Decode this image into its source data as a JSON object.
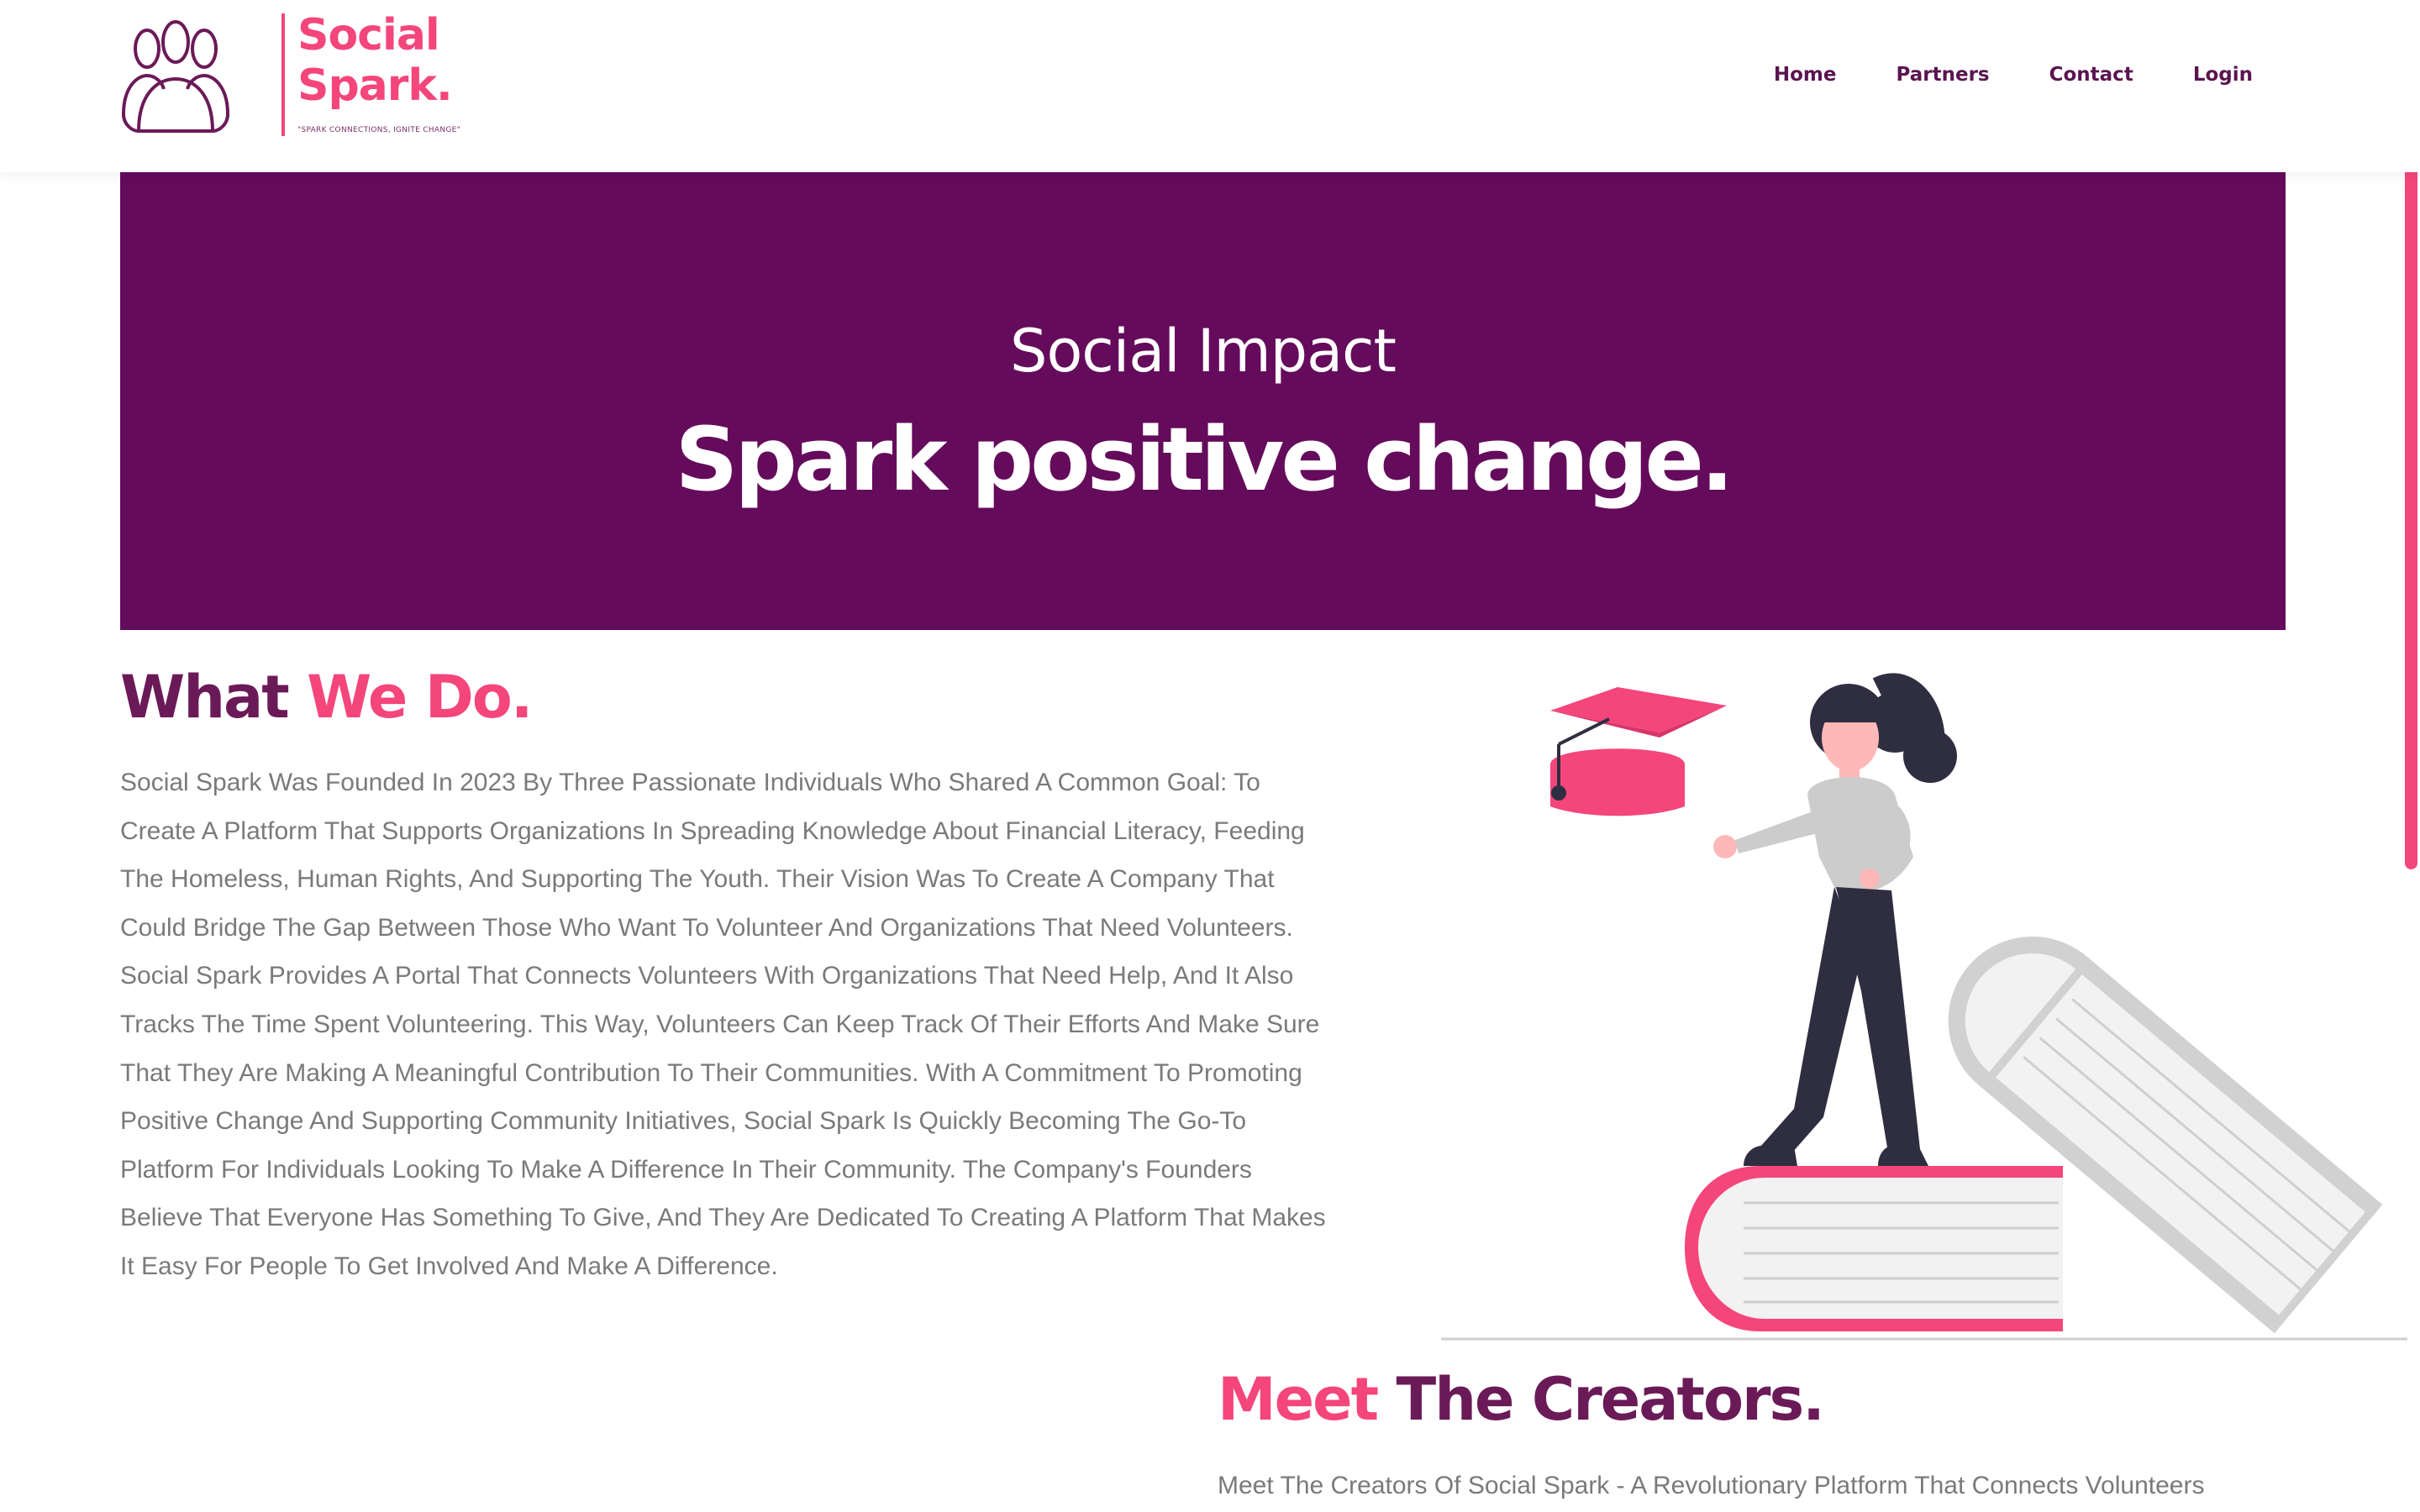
{
  "brand": {
    "name_line1": "Social",
    "name_line2": "Spark.",
    "tagline": "\"SPARK CONNECTIONS, IGNITE CHANGE\""
  },
  "nav": {
    "home": "Home",
    "partners": "Partners",
    "contact": "Contact",
    "login": "Login"
  },
  "hero": {
    "kicker": "Social Impact",
    "title": "Spark positive change."
  },
  "what_we_do": {
    "heading_part1": "What",
    "heading_part2": "We Do.",
    "body": "Social Spark Was Founded In 2023 By Three Passionate Individuals Who Shared A Common Goal: To Create A Platform That Supports Organizations In Spreading Knowledge About Financial Literacy, Feeding The Homeless, Human Rights, And Supporting The Youth. Their Vision Was To Create A Company That Could Bridge The Gap Between Those Who Want To Volunteer And Organizations That Need Volunteers. Social Spark Provides A Portal That Connects Volunteers With Organizations That Need Help, And It Also Tracks The Time Spent Volunteering. This Way, Volunteers Can Keep Track Of Their Efforts And Make Sure That They Are Making A Meaningful Contribution To Their Communities. With A Commitment To Promoting Positive Change And Supporting Community Initiatives, Social Spark Is Quickly Becoming The Go-To Platform For Individuals Looking To Make A Difference In Their Community. The Company's Founders Believe That Everyone Has Something To Give, And They Are Dedicated To Creating A Platform That Makes It Easy For People To Get Involved And Make A Difference."
  },
  "creators": {
    "heading_part1": "Meet",
    "heading_part2": "The Creators.",
    "body": "Meet The Creators Of Social Spark - A Revolutionary Platform That Connects Volunteers"
  },
  "colors": {
    "accent_pink": "#f4467b",
    "brand_purple": "#650b5b",
    "heading_dark": "#6b1a58",
    "body_gray": "#7a7a7a"
  },
  "icons": [
    "people-group-icon",
    "graduation-cap-icon",
    "woman-on-books-illustration"
  ]
}
